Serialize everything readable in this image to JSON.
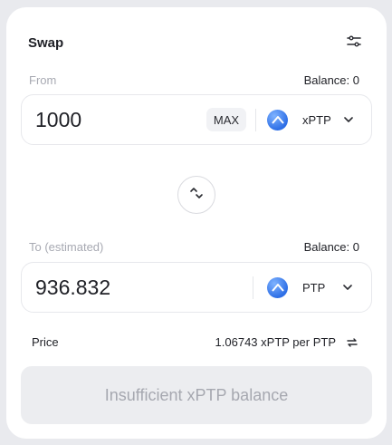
{
  "title": "Swap",
  "from": {
    "label": "From",
    "balance": "Balance: 0",
    "amount": "1000",
    "max_label": "MAX",
    "token": "xPTP"
  },
  "to": {
    "label": "To (estimated)",
    "balance": "Balance: 0",
    "amount": "936.832",
    "token": "PTP"
  },
  "price": {
    "label": "Price",
    "value": "1.06743 xPTP per PTP"
  },
  "submit_label": "Insufficient xPTP balance",
  "colors": {
    "token_logo": "#2e6fe6",
    "disabled_text": "#a6a8b0",
    "disabled_bg": "#ecedf0"
  }
}
